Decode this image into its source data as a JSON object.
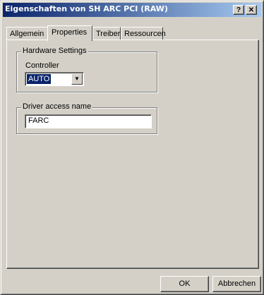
{
  "window": {
    "title": "Eigenschaften von SH ARC PCI (RAW)",
    "help_glyph": "?",
    "close_glyph": "✕"
  },
  "tabs": [
    {
      "label": "Allgemein",
      "active": false
    },
    {
      "label": "Properties",
      "active": true
    },
    {
      "label": "Treiber",
      "active": false
    },
    {
      "label": "Ressourcen",
      "active": false
    }
  ],
  "hardware_settings": {
    "legend": "Hardware Settings",
    "controller_label": "Controller",
    "controller_value": "AUTO",
    "dropdown_glyph": "▼"
  },
  "driver": {
    "legend": "Driver access name",
    "value": "FARC"
  },
  "buttons": {
    "ok": "OK",
    "cancel": "Abbrechen"
  },
  "colors": {
    "title_bar_start": "#0a246a",
    "title_bar_end": "#a6caf0",
    "face": "#d4d0c8",
    "selection": "#0a246a"
  }
}
